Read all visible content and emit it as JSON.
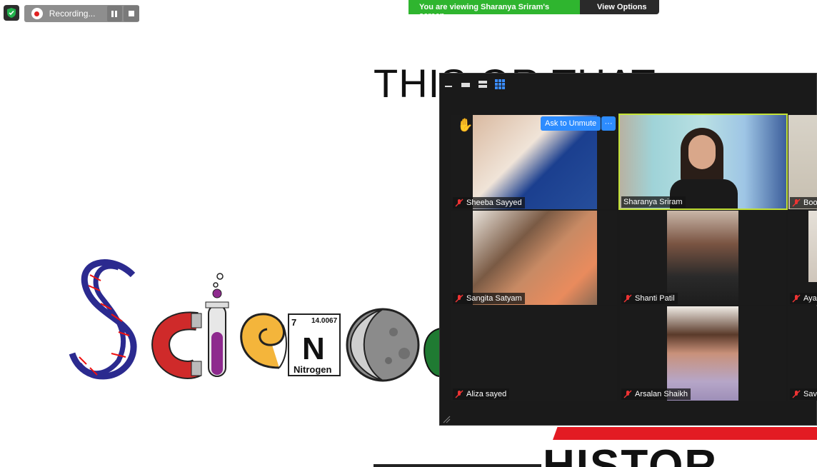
{
  "recording": {
    "label": "Recording..."
  },
  "banner": {
    "viewing_text": "You are viewing Sharanya Sriram's screen",
    "view_options_label": "View Options"
  },
  "slide": {
    "title": "THIS OR THAT",
    "element_card": {
      "number": "7",
      "mass": "14.0067",
      "symbol": "N",
      "name": "Nitrogen"
    },
    "bottom_text": "HISTOR"
  },
  "gallery": {
    "ask_unmute_label": "Ask to Unmute",
    "more_label": "···",
    "participants": [
      {
        "name": "Sheeba Sayyed"
      },
      {
        "name": "Sharanya Sriram"
      },
      {
        "name": "Boo"
      },
      {
        "name": "Sangita Satyam"
      },
      {
        "name": "Shanti Patil"
      },
      {
        "name": "Aya"
      },
      {
        "name": "Aliza sayed"
      },
      {
        "name": "Arsalan Shaikh"
      },
      {
        "name": "Savi"
      }
    ]
  },
  "colors": {
    "banner_green": "#2fb52f",
    "active_speaker": "#c4e236",
    "accent_blue": "#2d8cff",
    "red_stripe": "#e31b23"
  }
}
